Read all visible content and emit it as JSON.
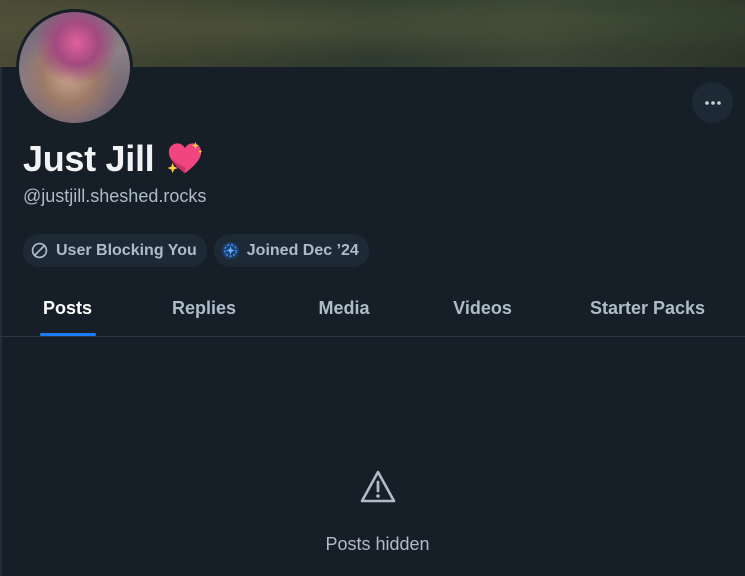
{
  "profile": {
    "display_name": "Just Jill",
    "name_emoji": "sparkling-heart",
    "handle": "@justjill.sheshed.rocks",
    "more_icon": "ellipsis-icon"
  },
  "badges": [
    {
      "label": "User Blocking You",
      "icon": "block-icon"
    },
    {
      "label": "Joined Dec ’24",
      "icon": "bluesky-starter-icon"
    }
  ],
  "tabs": [
    {
      "label": "Posts",
      "active": true
    },
    {
      "label": "Replies",
      "active": false
    },
    {
      "label": "Media",
      "active": false
    },
    {
      "label": "Videos",
      "active": false
    },
    {
      "label": "Starter Packs",
      "active": false
    }
  ],
  "empty_state": {
    "icon": "warning-triangle-icon",
    "message": "Posts hidden"
  },
  "colors": {
    "background": "#161e27",
    "accent": "#1a7cf6",
    "muted_text": "#aebbc9",
    "pill_bg": "#1e2936"
  }
}
